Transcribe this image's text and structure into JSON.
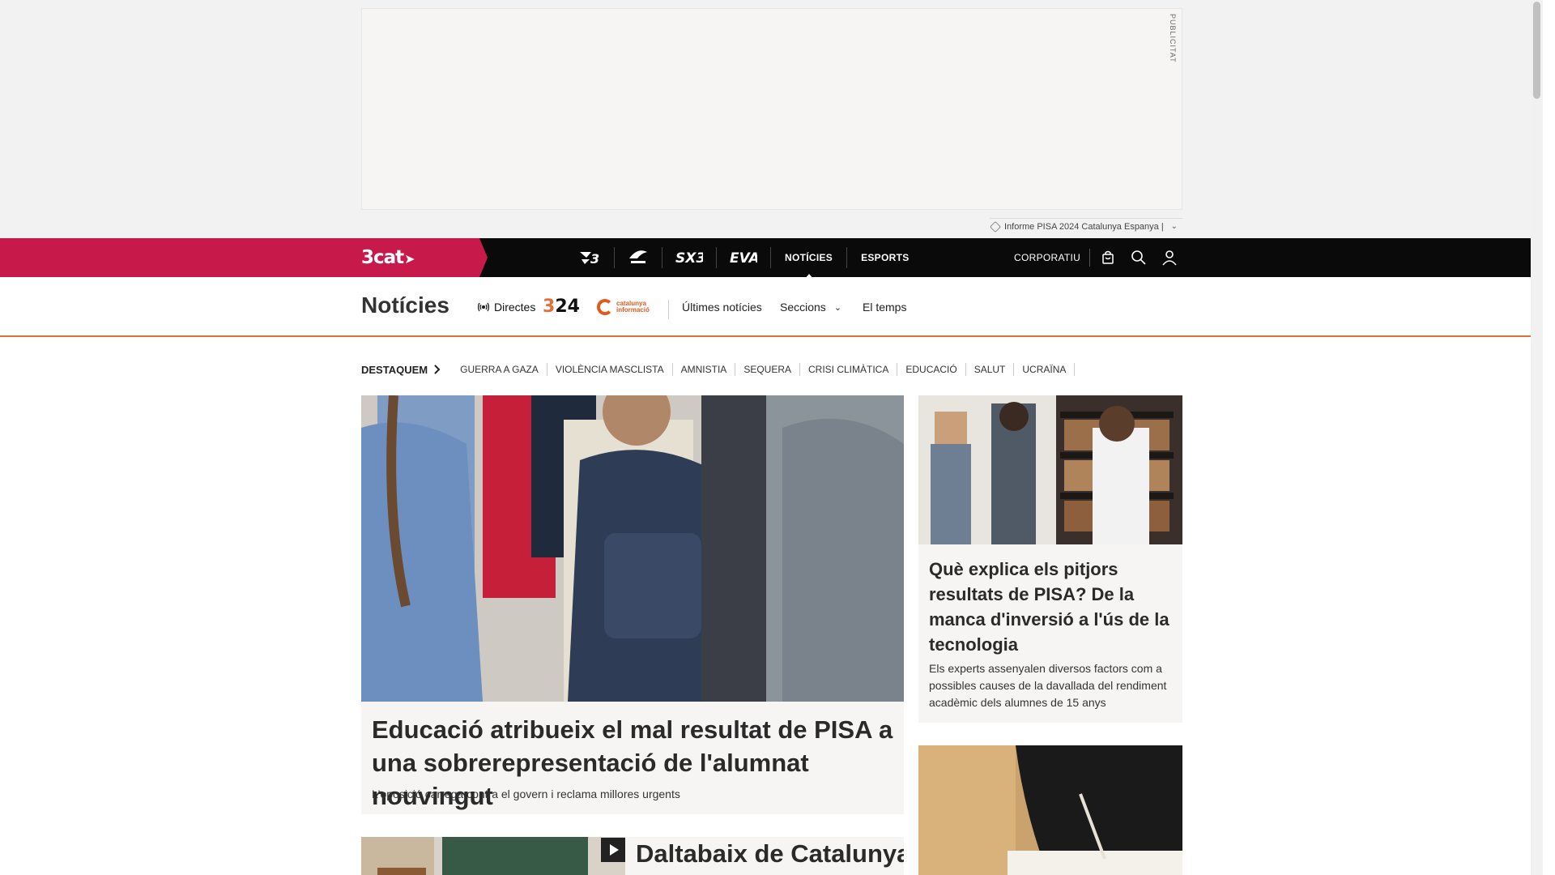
{
  "ad": {
    "label": "PUBLICITAT"
  },
  "topic_tag": {
    "label": "Informe PISA 2024 Catalunya Espanya |"
  },
  "brand": {
    "logo": "3cat"
  },
  "channels": [
    "NOTÍCIES",
    "ESPORTS"
  ],
  "nav": {
    "corporate": "CORPORATIU"
  },
  "section": {
    "title": "Notícies",
    "live_label": "Directes",
    "logo_324": "324",
    "logo_ci": "catalunya informació",
    "links": [
      "Últimes notícies",
      "Seccions",
      "El temps"
    ]
  },
  "featured": {
    "lead": "DESTAQUEM",
    "tags": [
      "GUERRA A GAZA",
      "VIOLÈNCIA MASCLISTA",
      "AMNISTIA",
      "SEQUERA",
      "CRISI CLIMÀTICA",
      "EDUCACIÓ",
      "SALUT",
      "UCRAÏNA"
    ]
  },
  "main_article": {
    "title": "Educació atribueix el mal resultat de PISA a una sobrerepresentació de l'alumnat nouvingut",
    "subtitle": "L'oposició carrega contra el govern i reclama millores urgents"
  },
  "side_article": {
    "title": "Què explica els pitjors resultats de PISA? De la manca d'inversió a l'ús de la tecnologia",
    "subtitle": "Els experts assenyalen diversos factors com a possibles causes de la davallada del rendiment acadèmic dels alumnes de 15 anys"
  },
  "bottom_article": {
    "title": "Daltabaix de Catalunya"
  }
}
